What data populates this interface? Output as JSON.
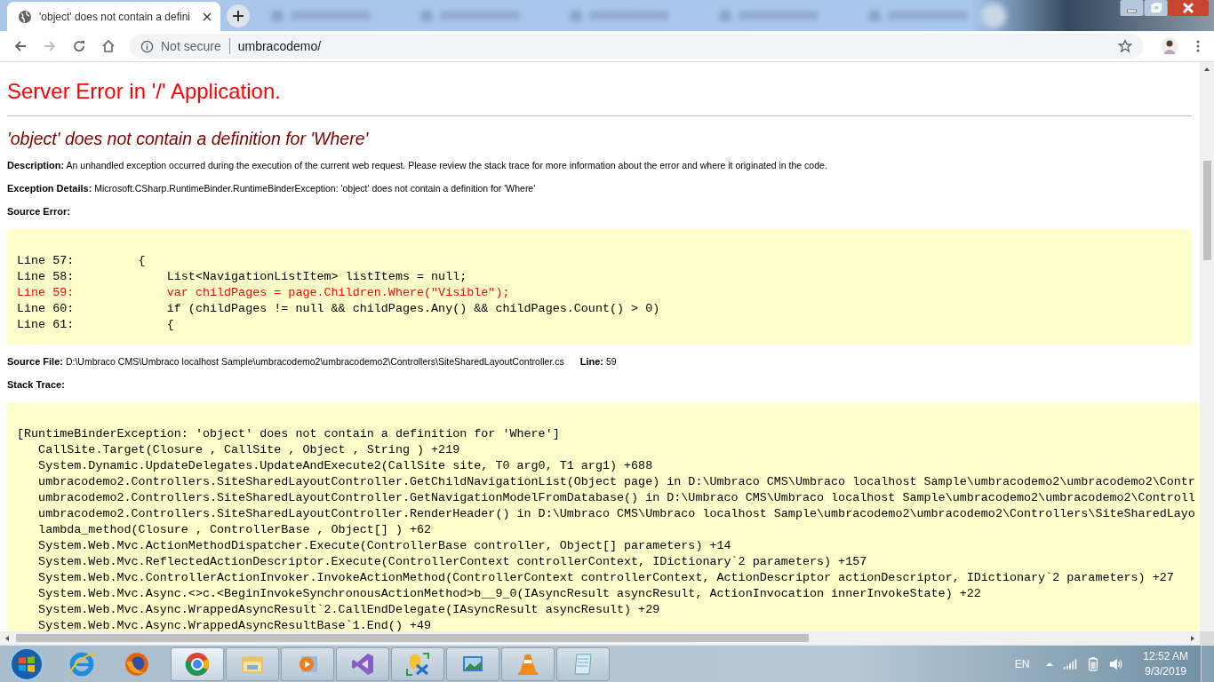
{
  "browser": {
    "active_tab": {
      "title": "'object' does not contain a defini",
      "selected": true
    },
    "security": "Not secure",
    "url": "umbracodemo/"
  },
  "page": {
    "title": "Server Error in '/' Application.",
    "error_heading": "'object' does not contain a definition for 'Where'",
    "details": [
      {
        "label": "Description:",
        "text": "An unhandled exception occurred during the execution of the current web request. Please review the stack trace for more information about the error and where it originated in the code."
      },
      {
        "label": "Exception Details:",
        "text": "Microsoft.CSharp.RuntimeBinder.RuntimeBinderException: 'object' does not contain a definition for 'Where'"
      }
    ],
    "source_error_label": "Source Error:",
    "source_lines": [
      {
        "text": "Line 57:         {",
        "highlighted": false
      },
      {
        "text": "Line 58:             List<NavigationListItem> listItems = null;",
        "highlighted": false
      },
      {
        "text": "Line 59:             var childPages = page.Children.Where(\"Visible\");",
        "highlighted": true
      },
      {
        "text": "Line 60:             if (childPages != null && childPages.Any() && childPages.Count() > 0)",
        "highlighted": false
      },
      {
        "text": "Line 61:             {",
        "highlighted": false
      }
    ],
    "source_file": {
      "label": "Source File:",
      "path": "D:\\Umbraco CMS\\Umbraco localhost Sample\\umbracodemo2\\umbracodemo2\\Controllers\\SiteSharedLayoutController.cs",
      "line_label": "Line:",
      "line": "59"
    },
    "stack_trace_label": "Stack Trace:",
    "stack_trace": [
      "[RuntimeBinderException: 'object' does not contain a definition for 'Where']",
      "   CallSite.Target(Closure , CallSite , Object , String ) +219",
      "   System.Dynamic.UpdateDelegates.UpdateAndExecute2(CallSite site, T0 arg0, T1 arg1) +688",
      "   umbracodemo2.Controllers.SiteSharedLayoutController.GetChildNavigationList(Object page) in D:\\Umbraco CMS\\Umbraco localhost Sample\\umbracodemo2\\umbracodemo2\\Contr",
      "   umbracodemo2.Controllers.SiteSharedLayoutController.GetNavigationModelFromDatabase() in D:\\Umbraco CMS\\Umbraco localhost Sample\\umbracodemo2\\umbracodemo2\\Controll",
      "   umbracodemo2.Controllers.SiteSharedLayoutController.RenderHeader() in D:\\Umbraco CMS\\Umbraco localhost Sample\\umbracodemo2\\umbracodemo2\\Controllers\\SiteSharedLayo",
      "   lambda_method(Closure , ControllerBase , Object[] ) +62",
      "   System.Web.Mvc.ActionMethodDispatcher.Execute(ControllerBase controller, Object[] parameters) +14",
      "   System.Web.Mvc.ReflectedActionDescriptor.Execute(ControllerContext controllerContext, IDictionary`2 parameters) +157",
      "   System.Web.Mvc.ControllerActionInvoker.InvokeActionMethod(ControllerContext controllerContext, ActionDescriptor actionDescriptor, IDictionary`2 parameters) +27",
      "   System.Web.Mvc.Async.<>c.<BeginInvokeSynchronousActionMethod>b__9_0(IAsyncResult asyncResult, ActionInvocation innerInvokeState) +22",
      "   System.Web.Mvc.Async.WrappedAsyncResult`2.CallEndDelegate(IAsyncResult asyncResult) +29",
      "   System.Web.Mvc.Async.WrappedAsyncResultBase`1.End() +49"
    ]
  },
  "taskbar": {
    "language": "EN",
    "time": "12:52 AM",
    "date": "9/3/2019"
  }
}
